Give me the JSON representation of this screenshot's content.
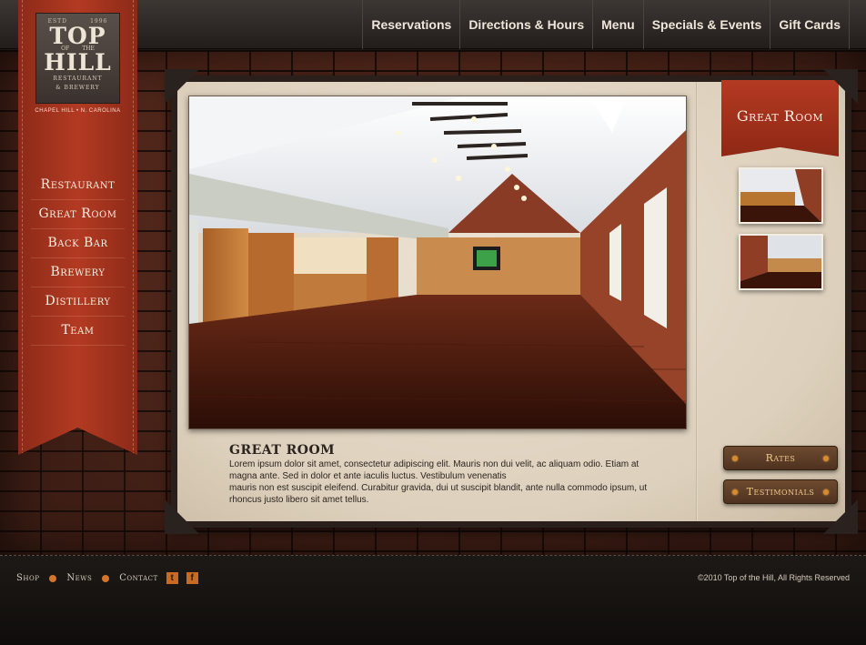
{
  "nav": {
    "items": [
      "Reservations",
      "Directions & Hours",
      "Menu",
      "Specials & Events",
      "Gift Cards"
    ]
  },
  "logo": {
    "estd": "ESTD",
    "year": "1996",
    "top": "TOP",
    "of": "OF",
    "the": "THE",
    "hill": "HILL",
    "line1": "RESTAURANT",
    "line2": "& BREWERY"
  },
  "location": "CHAPEL HILL • N. CAROLINA",
  "sidebar": {
    "items": [
      "Restaurant",
      "Great Room",
      "Back Bar",
      "Brewery",
      "Distillery",
      "Team"
    ]
  },
  "content": {
    "banner": "Great Room",
    "title": "GREAT ROOM",
    "body_line1": "Lorem ipsum dolor sit amet, consectetur adipiscing elit. Mauris non dui velit, ac aliquam odio. Etiam at magna ante. Sed in dolor et ante iaculis luctus. Vestibulum venenatis",
    "body_line2": "mauris non est suscipit eleifend. Curabitur gravida, dui ut suscipit blandit, ante nulla commodo ipsum, ut rhoncus justo libero sit amet tellus.",
    "buttons": [
      "Rates",
      "Testimonials"
    ]
  },
  "footer": {
    "links": [
      "Shop",
      "News",
      "Contact"
    ],
    "twitter_glyph": "t",
    "facebook_glyph": "f",
    "copyright": "©2010 Top of the Hill, All Rights Reserved"
  },
  "colors": {
    "ribbon_red": "#a3321d",
    "accent_orange": "#d1762a",
    "paper": "#e6dccb"
  }
}
